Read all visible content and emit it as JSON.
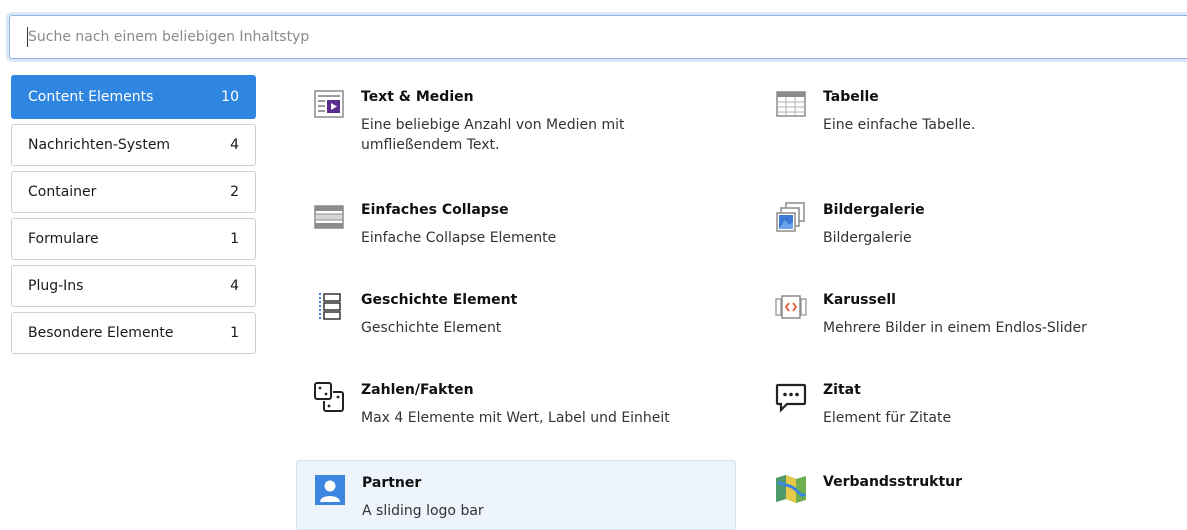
{
  "search": {
    "placeholder": "Suche nach einem beliebigen Inhaltstyp",
    "value": ""
  },
  "categories": [
    {
      "label": "Content Elements",
      "count": "10",
      "active": true
    },
    {
      "label": "Nachrichten-System",
      "count": "4"
    },
    {
      "label": "Container",
      "count": "2"
    },
    {
      "label": "Formulare",
      "count": "1"
    },
    {
      "label": "Plug-Ins",
      "count": "4"
    },
    {
      "label": "Besondere Elemente",
      "count": "1"
    }
  ],
  "elements": [
    {
      "title": "Text & Medien",
      "desc": "Eine beliebige Anzahl von Medien mit umfließendem Text.",
      "icon": "text-media-icon"
    },
    {
      "title": "Tabelle",
      "desc": "Eine einfache Tabelle.",
      "icon": "table-icon"
    },
    {
      "title": "Einfaches Collapse",
      "desc": "Einfache Collapse Elemente",
      "icon": "collapse-icon"
    },
    {
      "title": "Bildergalerie",
      "desc": "Bildergalerie",
      "icon": "gallery-icon"
    },
    {
      "title": "Geschichte Element",
      "desc": "Geschichte Element",
      "icon": "timeline-icon"
    },
    {
      "title": "Karussell",
      "desc": "Mehrere Bilder in einem Endlos-Slider",
      "icon": "carousel-icon"
    },
    {
      "title": "Zahlen/Fakten",
      "desc": "Max 4 Elemente mit Wert, Label und Einheit",
      "icon": "numbers-facts-icon"
    },
    {
      "title": "Zitat",
      "desc": "Element für Zitate",
      "icon": "quote-icon"
    },
    {
      "title": "Partner",
      "desc": "A sliding logo bar",
      "icon": "partner-user-icon"
    },
    {
      "title": "Verbandsstruktur",
      "desc": "",
      "icon": "map-icon"
    }
  ],
  "colors": {
    "accent": "#2f86e0",
    "hover": "#eef4fc",
    "icon_purple": "#5b2d8e"
  }
}
